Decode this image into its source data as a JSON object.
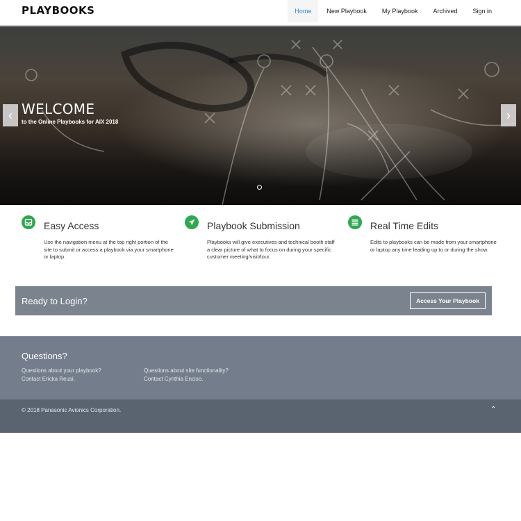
{
  "header": {
    "brand": "PLAYBOOKS",
    "nav": [
      {
        "label": "Home",
        "active": true
      },
      {
        "label": "New Playbook",
        "active": false
      },
      {
        "label": "My Playbook",
        "active": false
      },
      {
        "label": "Archived",
        "active": false
      },
      {
        "label": "Sign in",
        "active": false
      }
    ]
  },
  "hero": {
    "title": "WELCOME",
    "subtitle": "to the Online Playbooks for AIX 2018",
    "prev_icon": "chevron-left-icon",
    "next_icon": "chevron-right-icon",
    "slide_count": 1,
    "active_slide": 1
  },
  "features": [
    {
      "icon": "inbox-icon",
      "title": "Easy Access",
      "text": "Use the navigation menu at the top right portion of the site to submit or access a playbook via your smartphone or laptop."
    },
    {
      "icon": "plane-icon",
      "title": "Playbook Submission",
      "text": "Playbooks will give executives and technical booth staff a clear picture of what to focus on during your specific customer meeting/visit/tour."
    },
    {
      "icon": "list-icon",
      "title": "Real Time Edits",
      "text": "Edits to playbooks can be made from your smartphone or laptop any time leading up to or during the show."
    }
  ],
  "cta": {
    "text": "Ready to Login?",
    "button": "Access Your Playbook"
  },
  "footer": {
    "title": "Questions?",
    "col1": {
      "line1": "Questions about your playbook?",
      "line2": "Contact Ericka Reusi."
    },
    "col2": {
      "line1": "Questions about site functionality?",
      "line2": "Contact Cynthia Enciso."
    },
    "copyright": "© 2018 Panasonic Avionics Corporation.",
    "up_icon": "chevron-up-icon"
  },
  "colors": {
    "accent_green": "#2fa84f",
    "nav_active": "#2a8ad4",
    "cta_bg": "#7b838e",
    "footer_bg": "#737d8b",
    "footer_bottom_bg": "#5a6370"
  }
}
